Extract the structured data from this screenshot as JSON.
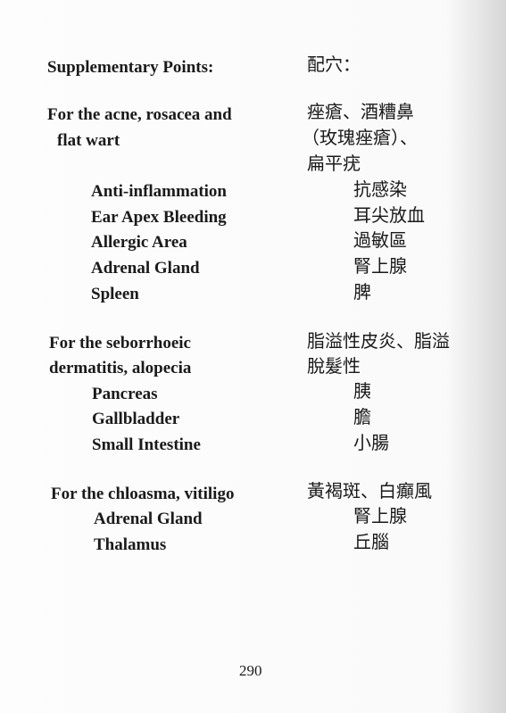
{
  "header": {
    "en": "Supplementary Points:",
    "zh": "配穴："
  },
  "groups": [
    {
      "condition_en": [
        "For the acne, rosacea and",
        "flat wart"
      ],
      "condition_zh": [
        "痤瘡、酒糟鼻",
        "（玫瑰痤瘡）、",
        "扁平疣"
      ],
      "points_en": [
        "Anti-inflammation",
        "Ear Apex Bleeding",
        "Allergic Area",
        "Adrenal Gland",
        "Spleen"
      ],
      "points_zh": [
        "抗感染",
        "耳尖放血",
        "過敏區",
        "腎上腺",
        "脾"
      ]
    },
    {
      "condition_en": [
        "For the seborrhoeic",
        "dermatitis, alopecia"
      ],
      "condition_zh": [
        "脂溢性皮炎、脂溢",
        "脫髮性"
      ],
      "points_en": [
        "Pancreas",
        "Gallbladder",
        "Small Intestine"
      ],
      "points_zh": [
        "胰",
        "膽",
        "小腸"
      ]
    },
    {
      "condition_en": [
        "For the chloasma, vitiligo"
      ],
      "condition_zh": [
        "黃褐斑、白癲風"
      ],
      "points_en": [
        "Adrenal Gland",
        "Thalamus"
      ],
      "points_zh": [
        "腎上腺",
        "丘腦"
      ]
    }
  ],
  "page_number": "290"
}
